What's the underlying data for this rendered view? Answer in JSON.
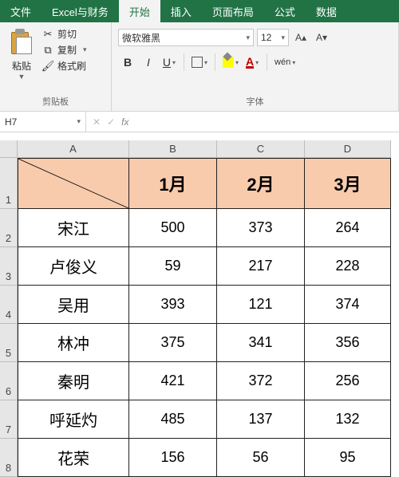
{
  "menu": {
    "tabs": [
      "文件",
      "Excel与财务",
      "开始",
      "插入",
      "页面布局",
      "公式",
      "数据"
    ],
    "active_index": 2
  },
  "ribbon": {
    "clipboard": {
      "paste": "粘贴",
      "cut": "剪切",
      "copy": "复制",
      "format_painter": "格式刷",
      "group_label": "剪贴板"
    },
    "font": {
      "name": "微软雅黑",
      "size": "12",
      "group_label": "字体",
      "bold": "B",
      "italic": "I",
      "underline": "U",
      "wen": "wén"
    }
  },
  "namebox": "H7",
  "grid": {
    "col_labels": [
      "A",
      "B",
      "C",
      "D"
    ],
    "row_labels": [
      "1",
      "2",
      "3",
      "4",
      "5",
      "6",
      "7",
      "8"
    ],
    "headers": [
      "",
      "1月",
      "2月",
      "3月"
    ],
    "rows": [
      {
        "name": "宋江",
        "v": [
          "500",
          "373",
          "264"
        ]
      },
      {
        "name": "卢俊义",
        "v": [
          "59",
          "217",
          "228"
        ]
      },
      {
        "name": "吴用",
        "v": [
          "393",
          "121",
          "374"
        ]
      },
      {
        "name": "林冲",
        "v": [
          "375",
          "341",
          "356"
        ]
      },
      {
        "name": "秦明",
        "v": [
          "421",
          "372",
          "256"
        ]
      },
      {
        "name": "呼延灼",
        "v": [
          "485",
          "137",
          "132"
        ]
      },
      {
        "name": "花荣",
        "v": [
          "156",
          "56",
          "95"
        ]
      }
    ]
  },
  "chart_data": {
    "type": "table",
    "categories": [
      "1月",
      "2月",
      "3月"
    ],
    "series": [
      {
        "name": "宋江",
        "values": [
          500,
          373,
          264
        ]
      },
      {
        "name": "卢俊义",
        "values": [
          59,
          217,
          228
        ]
      },
      {
        "name": "吴用",
        "values": [
          393,
          121,
          374
        ]
      },
      {
        "name": "林冲",
        "values": [
          375,
          341,
          356
        ]
      },
      {
        "name": "秦明",
        "values": [
          421,
          372,
          256
        ]
      },
      {
        "name": "呼延灼",
        "values": [
          485,
          137,
          132
        ]
      },
      {
        "name": "花荣",
        "values": [
          156,
          56,
          95
        ]
      }
    ]
  }
}
